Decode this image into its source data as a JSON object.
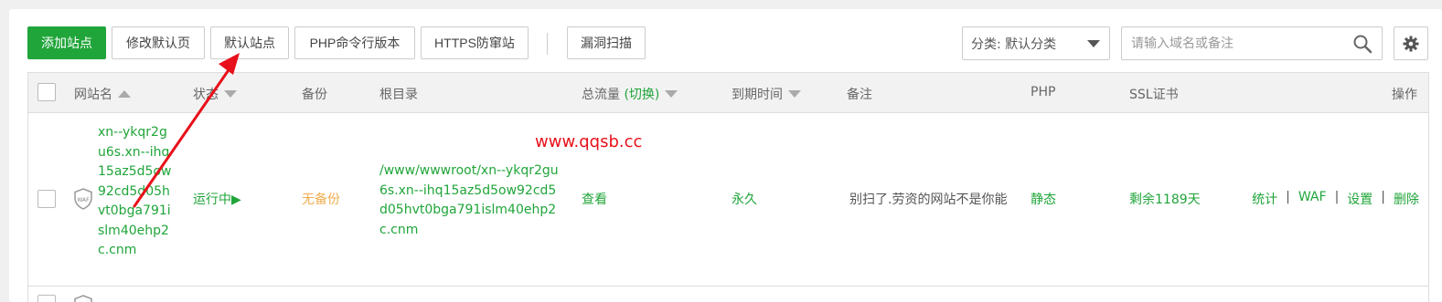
{
  "toolbar": {
    "add_site": "添加站点",
    "modify_default_page": "修改默认页",
    "default_site": "默认站点",
    "php_cli_version": "PHP命令行版本",
    "https_anti_snooping": "HTTPS防窜站",
    "vuln_scan": "漏洞扫描"
  },
  "filter": {
    "category": "分类: 默认分类",
    "search_placeholder": "请输入域名或备注"
  },
  "table": {
    "headers": {
      "site_name": "网站名",
      "status": "状态",
      "backup": "备份",
      "root_dir": "根目录",
      "traffic": "总流量",
      "traffic_switch": "(切换)",
      "expire": "到期时间",
      "note": "备注",
      "php": "PHP",
      "ssl": "SSL证书",
      "actions": "操作"
    },
    "rows": [
      {
        "site_name": "xn--ykqr2gu6s.xn--ihq15az5d5ow92cd5d05hvt0bga791islm40ehp2c.cnm",
        "waf_badge": "WAF",
        "status": "运行中▶",
        "backup": "无备份",
        "root_dir": "/www/wwwroot/xn--ykqr2gu6s.xn--ihq15az5d5ow92cd5d05hvt0bga791islm40ehp2c.cnm",
        "traffic": "查看",
        "expire": "永久",
        "note": "别扫了.劳资的网站不是你能",
        "php": "静态",
        "ssl": "剩余1189天",
        "actions": [
          "统计",
          "WAF",
          "设置",
          "删除"
        ]
      }
    ]
  },
  "watermark": "www.qqsb.cc",
  "colors": {
    "accent": "#20a53a",
    "warning": "#f0ad4e",
    "annotation": "#e8101a"
  }
}
